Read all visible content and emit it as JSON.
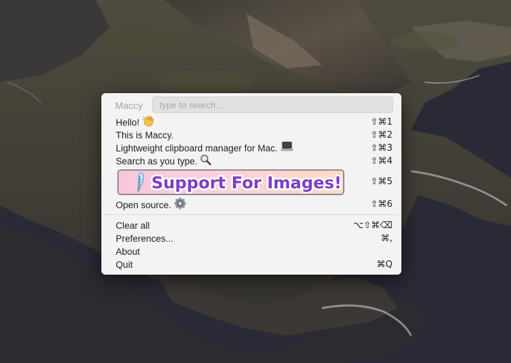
{
  "app": {
    "title": "Maccy"
  },
  "search": {
    "placeholder": "type to search..."
  },
  "history": [
    {
      "label": "Hello!",
      "emoji": "waving-hand-icon",
      "shortcut": "⇧⌘1"
    },
    {
      "label": "This is Maccy.",
      "emoji": "",
      "shortcut": "⇧⌘2"
    },
    {
      "label": "Lightweight clipboard manager for Mac.",
      "emoji": "laptop-icon",
      "shortcut": "⇧⌘3"
    },
    {
      "label": "Search as you type.",
      "emoji": "magnifier-icon",
      "shortcut": "⇧⌘4"
    },
    {
      "label": "Support For Images!",
      "type": "image",
      "emoji": "feather-icon",
      "shortcut": "⇧⌘5"
    },
    {
      "label": "Open source.",
      "emoji": "gear-icon",
      "shortcut": "⇧⌘6"
    }
  ],
  "footer": [
    {
      "label": "Clear all",
      "shortcut": "⌥⇧⌘⌫"
    },
    {
      "label": "Preferences...",
      "shortcut": "⌘,"
    },
    {
      "label": "About",
      "shortcut": ""
    },
    {
      "label": "Quit",
      "shortcut": "⌘Q"
    }
  ],
  "colors": {
    "popup_bg": "#f3f3f3",
    "title_gray": "#a2a2a2",
    "search_bg": "#e1e1e1",
    "image_gradient_start": "#f7c6dc",
    "image_gradient_end": "#fbdcc4",
    "image_text_fill": "#7c3fc4"
  }
}
